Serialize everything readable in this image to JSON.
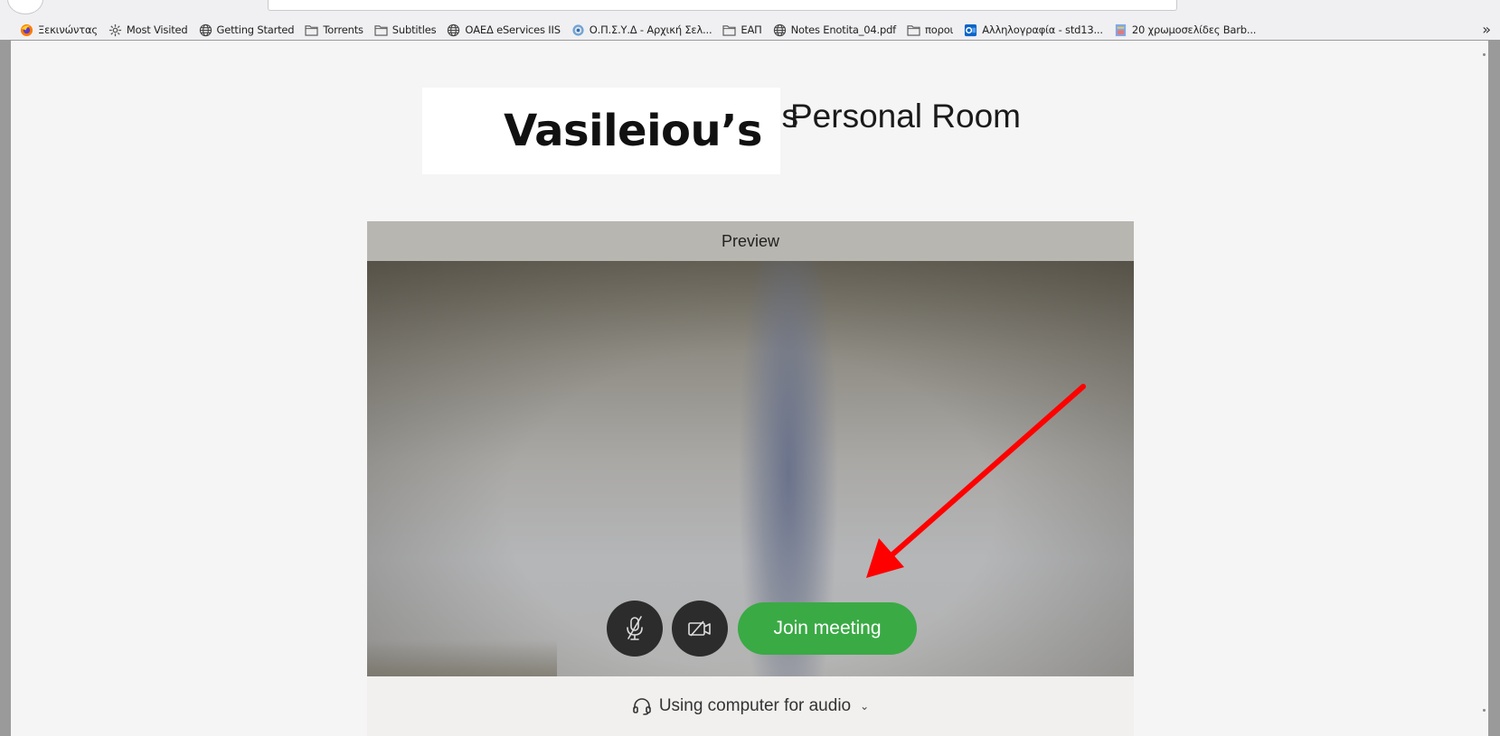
{
  "browser": {
    "bookmarks": [
      {
        "label": "Ξεκινώντας",
        "icon": "firefox-icon"
      },
      {
        "label": "Most Visited",
        "icon": "gear-icon"
      },
      {
        "label": "Getting Started",
        "icon": "globe-icon"
      },
      {
        "label": "Torrents",
        "icon": "folder-icon"
      },
      {
        "label": "Subtitles",
        "icon": "folder-icon"
      },
      {
        "label": "ΟΑΕΔ eServices IIS",
        "icon": "globe-icon"
      },
      {
        "label": "Ο.Π.Σ.Υ.Δ - Αρχική Σελ...",
        "icon": "globe-color-icon"
      },
      {
        "label": "ΕΑΠ",
        "icon": "folder-icon"
      },
      {
        "label": "Notes Enotita_04.pdf",
        "icon": "globe-icon"
      },
      {
        "label": "ποροι",
        "icon": "folder-icon"
      },
      {
        "label": "Αλληλογραφία - std13...",
        "icon": "outlook-icon"
      },
      {
        "label": "20 χρωμοσελίδες Barb...",
        "icon": "page-icon"
      }
    ],
    "overflow_label": "»"
  },
  "meeting": {
    "host_name": "Vasileiou’s",
    "title_suffix": "Personal Room",
    "title_apostrophe": "’s",
    "preview_label": "Preview",
    "join_label": "Join meeting",
    "audio_label": "Using computer for audio",
    "audio_chevron": "⌄"
  },
  "colors": {
    "join_green": "#3aaa45",
    "control_dark": "#2c2c2c",
    "annotation_red": "#ff0000"
  }
}
